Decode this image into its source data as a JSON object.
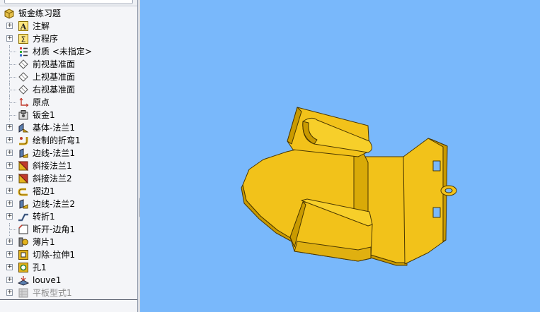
{
  "feature_tree": {
    "root": {
      "label": "钣金练习题",
      "icon": "part-icon"
    },
    "items": [
      {
        "label": "注解",
        "icon": "annotations-icon",
        "expandable": true
      },
      {
        "label": "方程序",
        "icon": "equations-icon",
        "expandable": true
      },
      {
        "label": "材质 <未指定>",
        "icon": "material-icon",
        "expandable": false
      },
      {
        "label": "前视基准面",
        "icon": "plane-icon",
        "expandable": false
      },
      {
        "label": "上视基准面",
        "icon": "plane-icon",
        "expandable": false
      },
      {
        "label": "右视基准面",
        "icon": "plane-icon",
        "expandable": false
      },
      {
        "label": "原点",
        "icon": "origin-icon",
        "expandable": false
      },
      {
        "label": "钣金1",
        "icon": "sheet-metal-icon",
        "expandable": false
      },
      {
        "label": "基体-法兰1",
        "icon": "base-flange-icon",
        "expandable": true
      },
      {
        "label": "绘制的折弯1",
        "icon": "sketched-bend-icon",
        "expandable": true
      },
      {
        "label": "边线-法兰1",
        "icon": "edge-flange-icon",
        "expandable": true
      },
      {
        "label": "斜接法兰1",
        "icon": "miter-flange-icon",
        "expandable": true
      },
      {
        "label": "斜接法兰2",
        "icon": "miter-flange-icon",
        "expandable": true
      },
      {
        "label": "褶边1",
        "icon": "hem-icon",
        "expandable": true
      },
      {
        "label": "边线-法兰2",
        "icon": "edge-flange-icon",
        "expandable": true
      },
      {
        "label": "转折1",
        "icon": "jog-icon",
        "expandable": true
      },
      {
        "label": "断开-边角1",
        "icon": "break-corner-icon",
        "expandable": false
      },
      {
        "label": "薄片1",
        "icon": "tab-icon",
        "expandable": true
      },
      {
        "label": "切除-拉伸1",
        "icon": "cut-extrude-icon",
        "expandable": true
      },
      {
        "label": "孔1",
        "icon": "hole-icon",
        "expandable": true
      },
      {
        "label": "louve1",
        "icon": "louver-icon",
        "expandable": true
      },
      {
        "label": "平板型式1",
        "icon": "flat-pattern-icon",
        "expandable": true,
        "suppressed": true
      }
    ]
  },
  "viewport": {
    "background_color": "#79b8fb",
    "model_color": "#f2c21a",
    "model_shadow_color": "#c99a00"
  }
}
